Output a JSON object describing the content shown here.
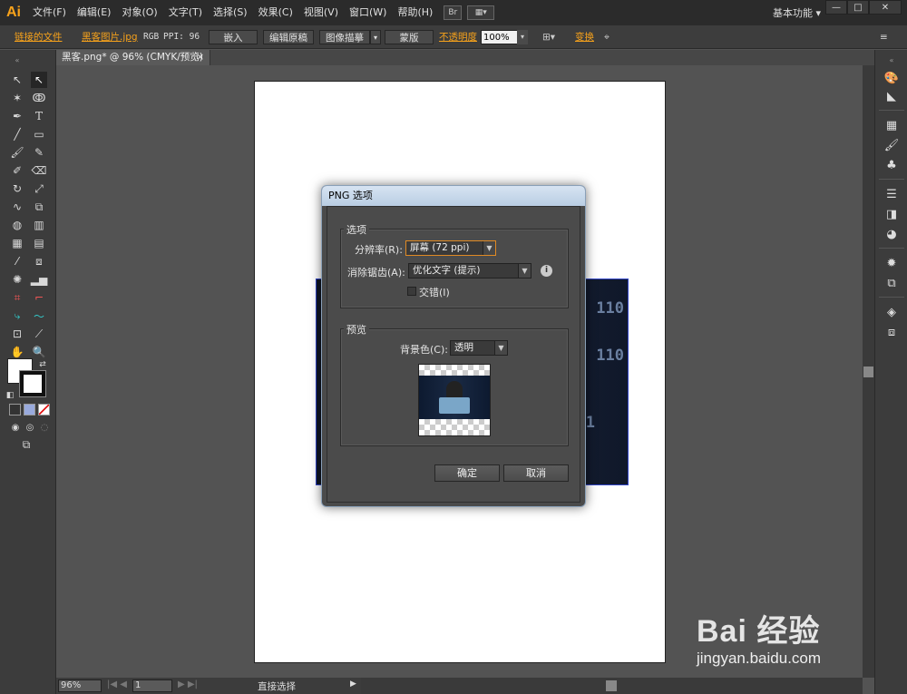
{
  "app": {
    "logo": "Ai",
    "workspace": "基本功能 ▾",
    "bridge_label": "Br"
  },
  "menu": [
    "文件(F)",
    "编辑(E)",
    "对象(O)",
    "文字(T)",
    "选择(S)",
    "效果(C)",
    "视图(V)",
    "窗口(W)",
    "帮助(H)"
  ],
  "window_buttons": {
    "minimize": "—",
    "maximize": "□",
    "close": "✕"
  },
  "control_bar": {
    "linked_file": "链接的文件",
    "filename": "黑客图片.jpg",
    "color_mode": "RGB",
    "ppi": "PPI: 96",
    "embed": "嵌入",
    "edit_original": "编辑原稿",
    "image_trace": "图像描摹",
    "mask": "蒙版",
    "opacity_label": "不透明度",
    "opacity_value": "100%",
    "transform": "变换"
  },
  "tab": {
    "title": "黑客.png* @ 96% (CMYK/预览)",
    "close": "×"
  },
  "status": {
    "zoom": "96%",
    "page": "1",
    "tool": "直接选择"
  },
  "dialog": {
    "title": "PNG 选项",
    "options_group": "选项",
    "resolution_label": "分辨率(R):",
    "resolution_value": "屏幕 (72 ppi)",
    "antialias_label": "消除锯齿(A):",
    "antialias_value": "优化文字 (提示)",
    "interlace_label": "交错(I)",
    "preview_group": "预览",
    "bg_label": "背景色(C):",
    "bg_value": "透明",
    "ok": "确定",
    "cancel": "取消"
  },
  "artwork": {
    "binary_1": "110",
    "binary_2": "110",
    "binary_3": "1"
  },
  "watermark": {
    "brand": "Bai 经验",
    "url": "jingyan.baidu.com"
  },
  "colors": {
    "accent": "#f7a21b",
    "selection": "#3246c8",
    "dialog_title": "#c8d8ea"
  }
}
